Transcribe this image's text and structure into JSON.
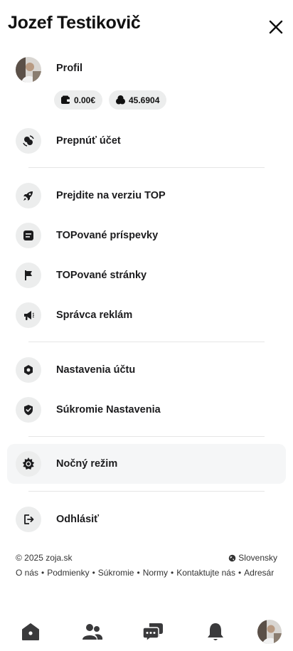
{
  "header": {
    "title": "Jozef Testikovič"
  },
  "profile": {
    "label": "Profil",
    "wallet_value": "0.00€",
    "coins_value": "45.6904"
  },
  "menu": {
    "switch_account": "Prepnúť účet",
    "upgrade_top": "Prejdite na verziu TOP",
    "top_posts": "TOPované príspevky",
    "top_pages": "TOPované stránky",
    "ad_manager": "Správca reklám",
    "account_settings": "Nastavenia účtu",
    "privacy_settings": "Súkromie Nastavenia",
    "night_mode": "Nočný režim",
    "logout": "Odhlásiť"
  },
  "footer": {
    "copyright": "© 2025 zoja.sk",
    "language": "Slovensky",
    "links": [
      "O nás",
      "Podmienky",
      "Súkromie",
      "Normy",
      "Kontaktujte nás",
      "Adresár"
    ]
  },
  "colors": {
    "accent": "#1c1c1e",
    "icon_bg": "#eceded",
    "nav_icon": "#3a3a3c"
  }
}
